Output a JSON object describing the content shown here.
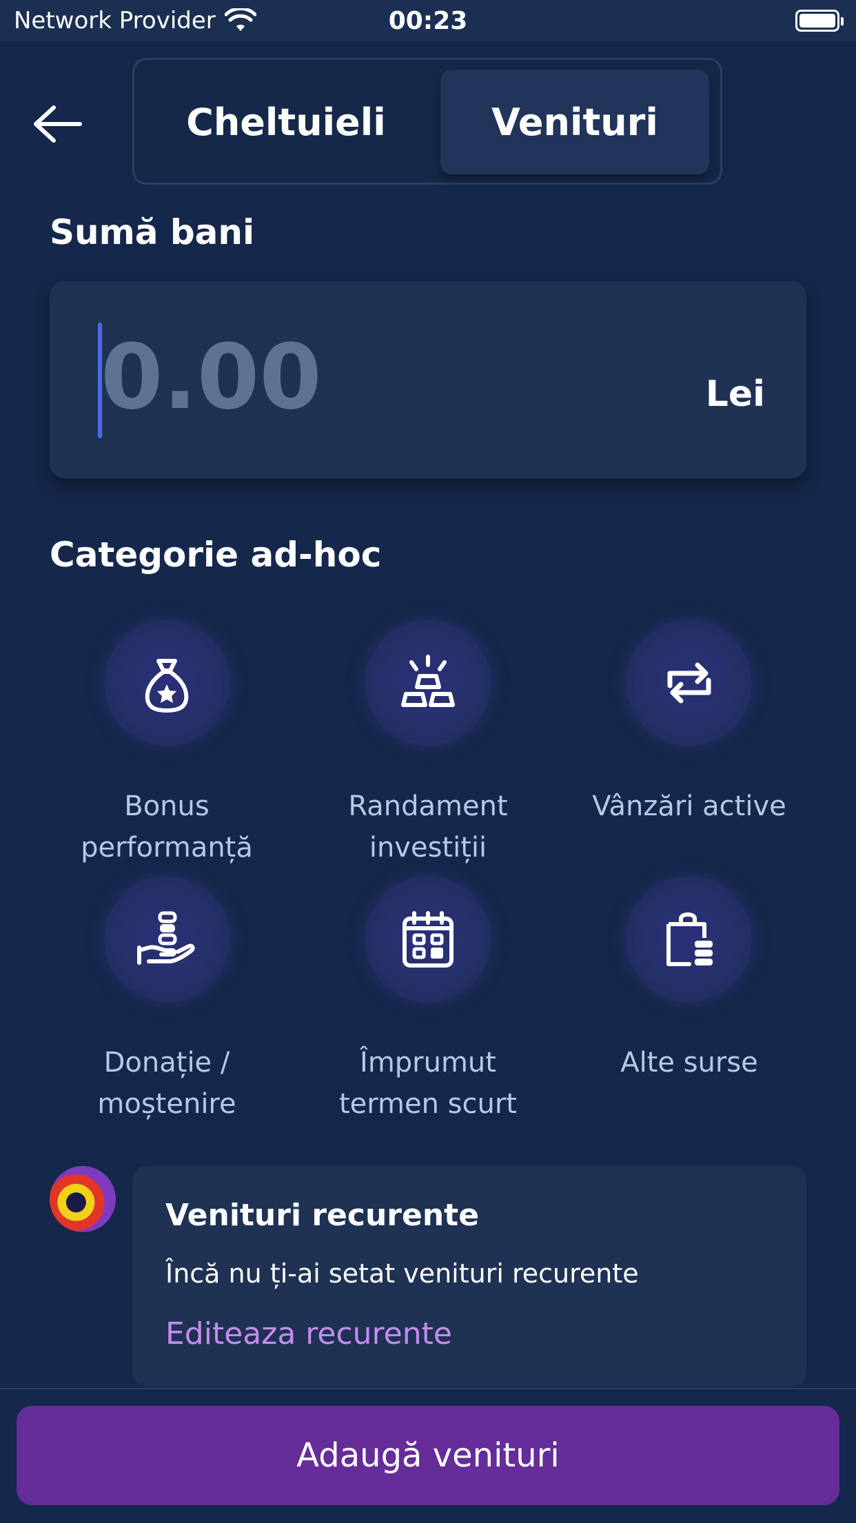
{
  "status_bar": {
    "provider": "Network Provider",
    "time": "00:23"
  },
  "header": {
    "tabs": [
      {
        "label": "Cheltuieli",
        "selected": false
      },
      {
        "label": "Venituri",
        "selected": true
      }
    ]
  },
  "amount": {
    "title": "Sumă bani",
    "placeholder": "0.00",
    "value": "",
    "currency": "Lei"
  },
  "categories": {
    "title": "Categorie ad-hoc",
    "items": [
      {
        "line1": "Bonus",
        "line2": "performanță",
        "icon": "money-bag-star-icon"
      },
      {
        "line1": "Randament",
        "line2": "investiții",
        "icon": "gold-bars-icon"
      },
      {
        "line1": "Vânzări active",
        "line2": "",
        "icon": "exchange-arrows-icon"
      },
      {
        "line1": "Donație /",
        "line2": "moștenire",
        "icon": "hand-coins-icon"
      },
      {
        "line1": "Împrumut",
        "line2": "termen scurt",
        "icon": "calendar-icon"
      },
      {
        "line1": "Alte surse",
        "line2": "",
        "icon": "shopping-bag-coins-icon"
      }
    ]
  },
  "recurring": {
    "title": "Venituri recurente",
    "description": "Încă nu ți-ai setat venituri recurente",
    "link": "Editeaza recurente"
  },
  "cta": {
    "label": "Adaugă venituri"
  },
  "colors": {
    "background": "#15274a",
    "card": "#1f3254",
    "accent": "#652c9a",
    "link": "#c58cf0",
    "caret": "#4c6ae6"
  }
}
